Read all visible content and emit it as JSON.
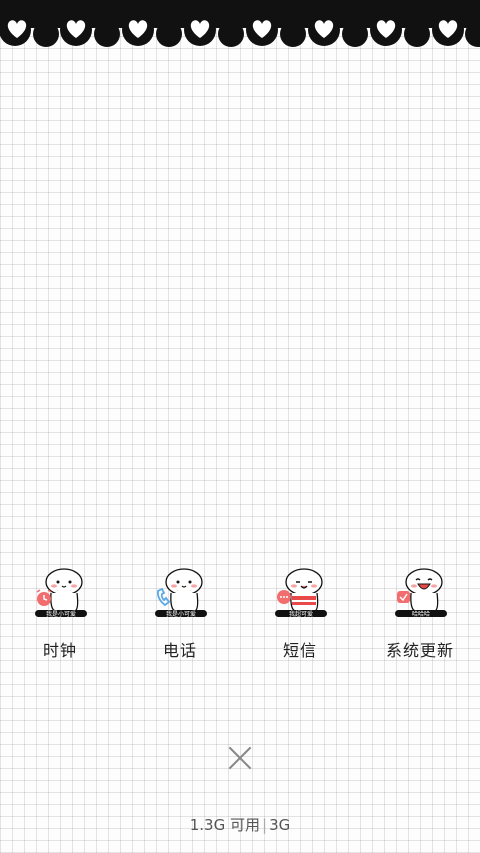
{
  "decoration": {
    "band_color": "#111111",
    "heart_color": "#ffffff",
    "heart_icon": "heart-icon"
  },
  "apps": [
    {
      "label": "时钟",
      "badge_text": "我是小可爱",
      "icon": "clock-icon",
      "accent": "#f26d6d"
    },
    {
      "label": "电话",
      "badge_text": "我是小可爱",
      "icon": "phone-icon",
      "accent": "#5aa9e6"
    },
    {
      "label": "短信",
      "badge_text": "我超可爱",
      "icon": "message-icon",
      "accent": "#f26d6d"
    },
    {
      "label": "系统更新",
      "badge_text": "哈哈哈",
      "icon": "update-icon",
      "accent": "#f26d6d"
    }
  ],
  "footer": {
    "memory_available": "1.3G 可用",
    "memory_total": "3G"
  }
}
